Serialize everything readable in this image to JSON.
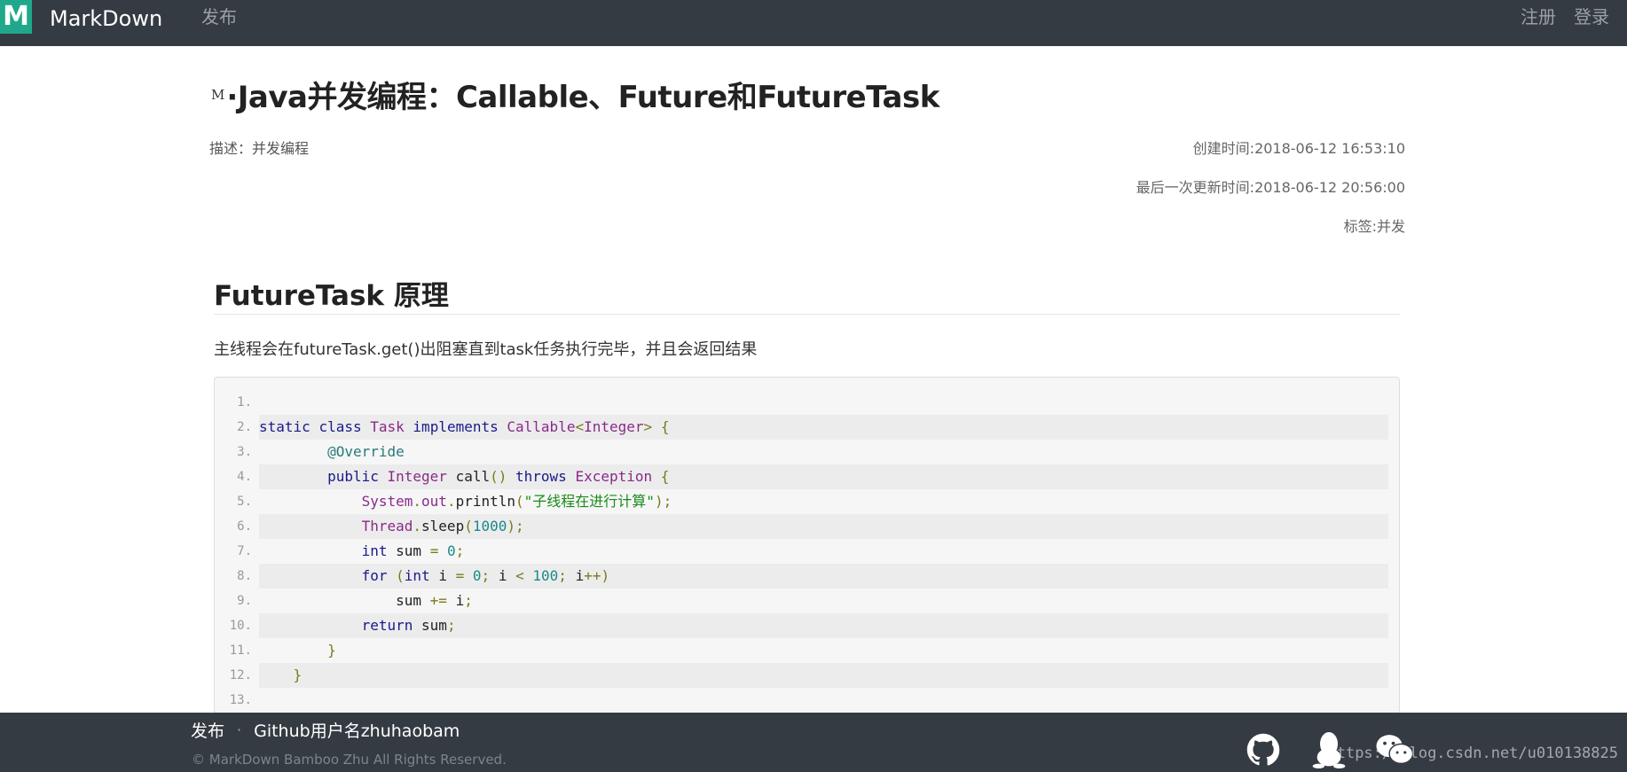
{
  "nav": {
    "logo_letter": "M",
    "brand": "MarkDown",
    "publish": "发布",
    "register": "注册",
    "login": "登录"
  },
  "article": {
    "title": "·Java并发编程：Callable、Future和FutureTask",
    "title_icon": "M",
    "description": "描述：并发编程",
    "created": "创建时间:2018-06-12 16:53:10",
    "updated": "最后一次更新时间:2018-06-12 20:56:00",
    "tags": "标签:并发",
    "section_heading": "FutureTask 原理",
    "paragraph": "主线程会在futureTask.get()出阻塞直到task任务执行完毕，并且会返回结果"
  },
  "code": {
    "line_numbers": [
      "1.",
      "2.",
      "3.",
      "4.",
      "5.",
      "6.",
      "7.",
      "8.",
      "9.",
      "10.",
      "11.",
      "12.",
      "13."
    ],
    "lines": [
      "",
      "static class Task implements Callable<Integer> {",
      "        @Override",
      "        public Integer call() throws Exception {",
      "            System.out.println(\"子线程在进行计算\");",
      "            Thread.sleep(1000);",
      "            int sum = 0;",
      "            for (int i = 0; i < 100; i++)",
      "                sum += i;",
      "            return sum;",
      "        }",
      "    }",
      ""
    ]
  },
  "footer": {
    "publish": "发布",
    "separator": "·",
    "github": "Github用户名zhuhaobam",
    "copyright": "© MarkDown Bamboo Zhu All Rights Reserved.",
    "watermark": "https://blog.csdn.net/u010138825",
    "icons": [
      "github-icon",
      "qq-icon",
      "wechat-icon"
    ]
  },
  "colors": {
    "topbar": "#353b43",
    "logo": "#20a88c",
    "code_bg": "#f6f6f6"
  }
}
